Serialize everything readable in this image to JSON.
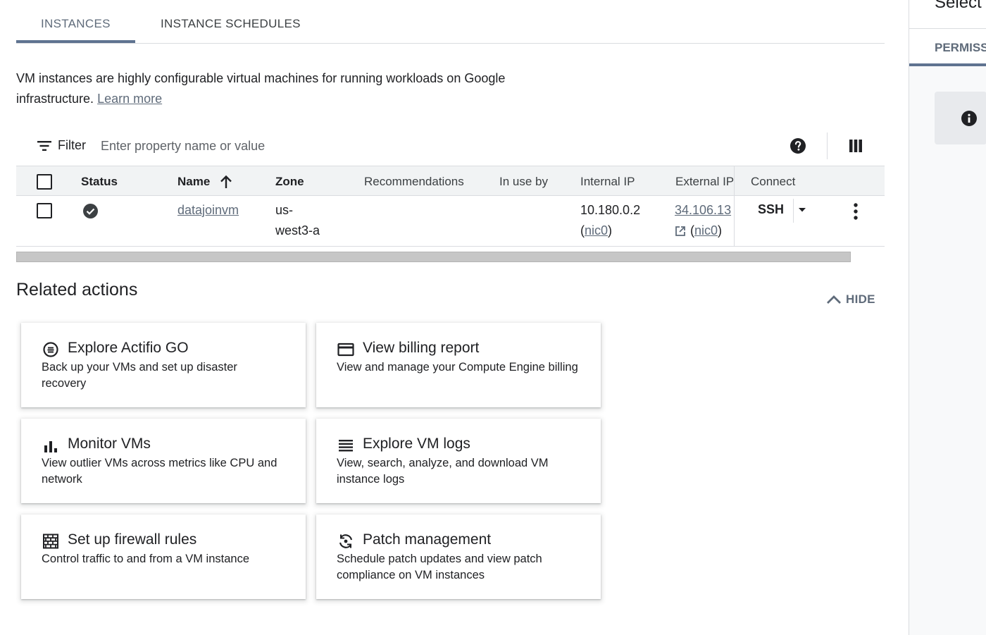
{
  "tabs": [
    {
      "label": "INSTANCES",
      "active": true
    },
    {
      "label": "INSTANCE SCHEDULES",
      "active": false
    }
  ],
  "description": {
    "text": "VM instances are highly configurable virtual machines for running workloads on Google infrastructure.",
    "link": "Learn more"
  },
  "filter": {
    "label": "Filter",
    "placeholder": "Enter property name or value",
    "icon": "filter-list-icon",
    "help_icon": "help-icon",
    "columns_icon": "column-display-icon"
  },
  "table": {
    "headers": {
      "status": "Status",
      "name": "Name",
      "zone": "Zone",
      "recommendations": "Recommendations",
      "in_use_by": "In use by",
      "internal_ip": "Internal IP",
      "external_ip": "External IP",
      "connect": "Connect"
    },
    "sort": {
      "column": "Name",
      "direction": "ascending",
      "icon": "arrow-up-icon"
    },
    "rows": [
      {
        "status_icon": "check-circle-icon",
        "name": "datajoinvm",
        "zone_line1": "us-",
        "zone_line2": "west3-a",
        "recommendations": "",
        "in_use_by": "",
        "internal_ip": "10.180.0.2",
        "internal_nic_open": "(",
        "internal_nic": "nic0",
        "internal_nic_close": ")",
        "external_ip": "34.106.13",
        "external_nic_open": "(",
        "external_nic": "nic0",
        "external_nic_close": ")",
        "external_icon": "open-in-new-icon",
        "connect_label": "SSH"
      }
    ]
  },
  "related_actions": {
    "title": "Related actions",
    "hide_label": "HIDE",
    "hide_icon": "chevron-up-icon",
    "cards": [
      {
        "icon": "actifio-icon",
        "title": "Explore Actifio GO",
        "description": "Back up your VMs and set up disaster recovery"
      },
      {
        "icon": "billing-card-icon",
        "title": "View billing report",
        "description": "View and manage your Compute Engine billing"
      },
      {
        "icon": "bar-chart-icon",
        "title": "Monitor VMs",
        "description": "View outlier VMs across metrics like CPU and network"
      },
      {
        "icon": "logs-list-icon",
        "title": "Explore VM logs",
        "description": "View, search, analyze, and download VM instance logs"
      },
      {
        "icon": "firewall-icon",
        "title": "Set up firewall rules",
        "description": "Control traffic to and from a VM instance"
      },
      {
        "icon": "patch-sync-icon",
        "title": "Patch management",
        "description": "Schedule patch updates and view patch compliance on VM instances"
      }
    ]
  },
  "side_panel": {
    "title": "Select",
    "tab": "PERMISS",
    "info_icon": "info-icon"
  },
  "colors": {
    "accent": "#5f7390",
    "link": "#5f6b7a",
    "text": "#202124",
    "header_bg": "#f1f3f4"
  }
}
